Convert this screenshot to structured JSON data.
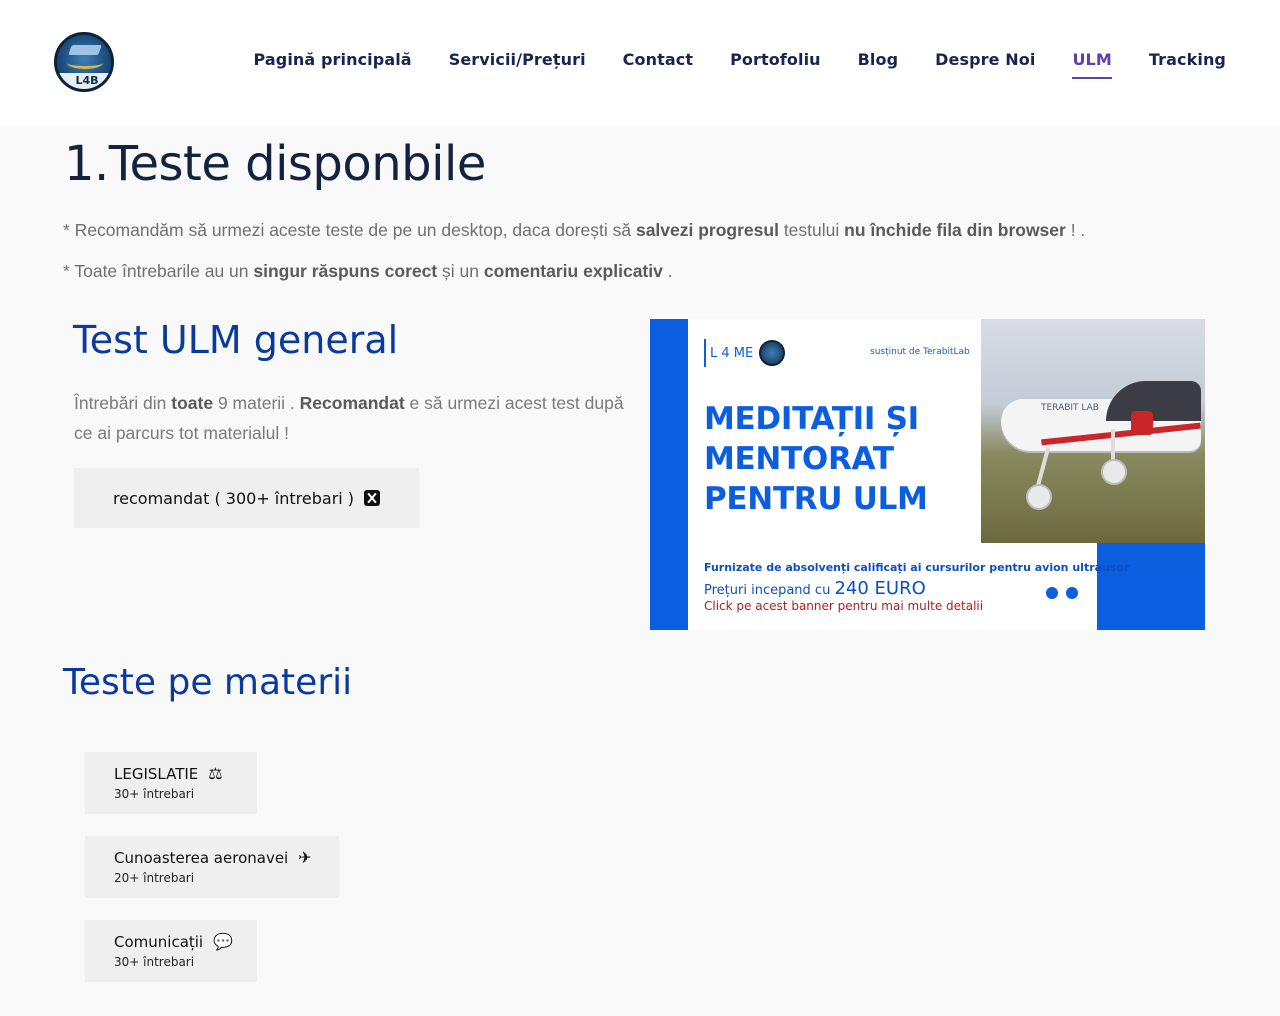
{
  "nav": {
    "items": [
      {
        "label": "Pagină principală",
        "active": false
      },
      {
        "label": "Servicii/Prețuri",
        "active": false
      },
      {
        "label": "Contact",
        "active": false
      },
      {
        "label": "Portofoliu",
        "active": false
      },
      {
        "label": "Blog",
        "active": false
      },
      {
        "label": "Despre Noi",
        "active": false
      },
      {
        "label": "ULM",
        "active": true
      },
      {
        "label": "Tracking",
        "active": false
      }
    ],
    "active_color": "#5b3fb3"
  },
  "logo": {
    "text": "L4B",
    "icon": "graduation-book-logo"
  },
  "page": {
    "title": "1.Teste disponbile",
    "note1": {
      "p1": "* Recomandăm să urmezi aceste teste de pe un desktop, daca dorești să ",
      "b1": "salvezi progresul",
      "p2": " testului ",
      "b2": "nu închide fila din browser",
      "p3": " ! ."
    },
    "note2": {
      "p1": "* Toate întrebarile au un ",
      "b1": "singur răspuns corect",
      "p2": " și un ",
      "b2": "comentariu explicativ",
      "p3": " ."
    }
  },
  "general_test": {
    "title": "Test ULM general",
    "desc": {
      "p1": "Întrebări din ",
      "b1": "toate",
      "p2": " 9 materii . ",
      "b2": "Recomandat",
      "p3": " e să urmezi acest test după ce ai parcurs tot materialul !"
    },
    "button_label": "recomandat ( 300+ întrebari )",
    "button_icon": "x-square-icon"
  },
  "banner": {
    "logo_text": "L 4 ME",
    "supported": "susținut de TerabitLab",
    "headline_lines": [
      "MEDITAȚII ȘI",
      "MENTORAT",
      "PENTRU ULM"
    ],
    "line1": "Furnizate de absolvenți calificați ai cursurilor pentru avion ultrausor",
    "line2_prefix": "Prețuri incepand cu ",
    "line2_price": "240 EURO",
    "line3": "Click pe acest banner pentru mai multe detalii",
    "plane_brand": "TERABIT LAB",
    "colors": {
      "blue": "#0c5ee0",
      "red": "#b01e1e"
    }
  },
  "subjects_section": {
    "title": "Teste pe materii",
    "items": [
      {
        "label": "LEGISLATIE",
        "count": "30+ întrebari",
        "icon": "scale-icon",
        "glyph": "⚖"
      },
      {
        "label": "Cunoasterea aeronavei",
        "count": "20+ întrebari",
        "icon": "airplane-icon",
        "glyph": "✈"
      },
      {
        "label": "Comunicații",
        "count": "30+ întrebari",
        "icon": "chat-bubbles-icon",
        "glyph": "💬"
      }
    ]
  }
}
